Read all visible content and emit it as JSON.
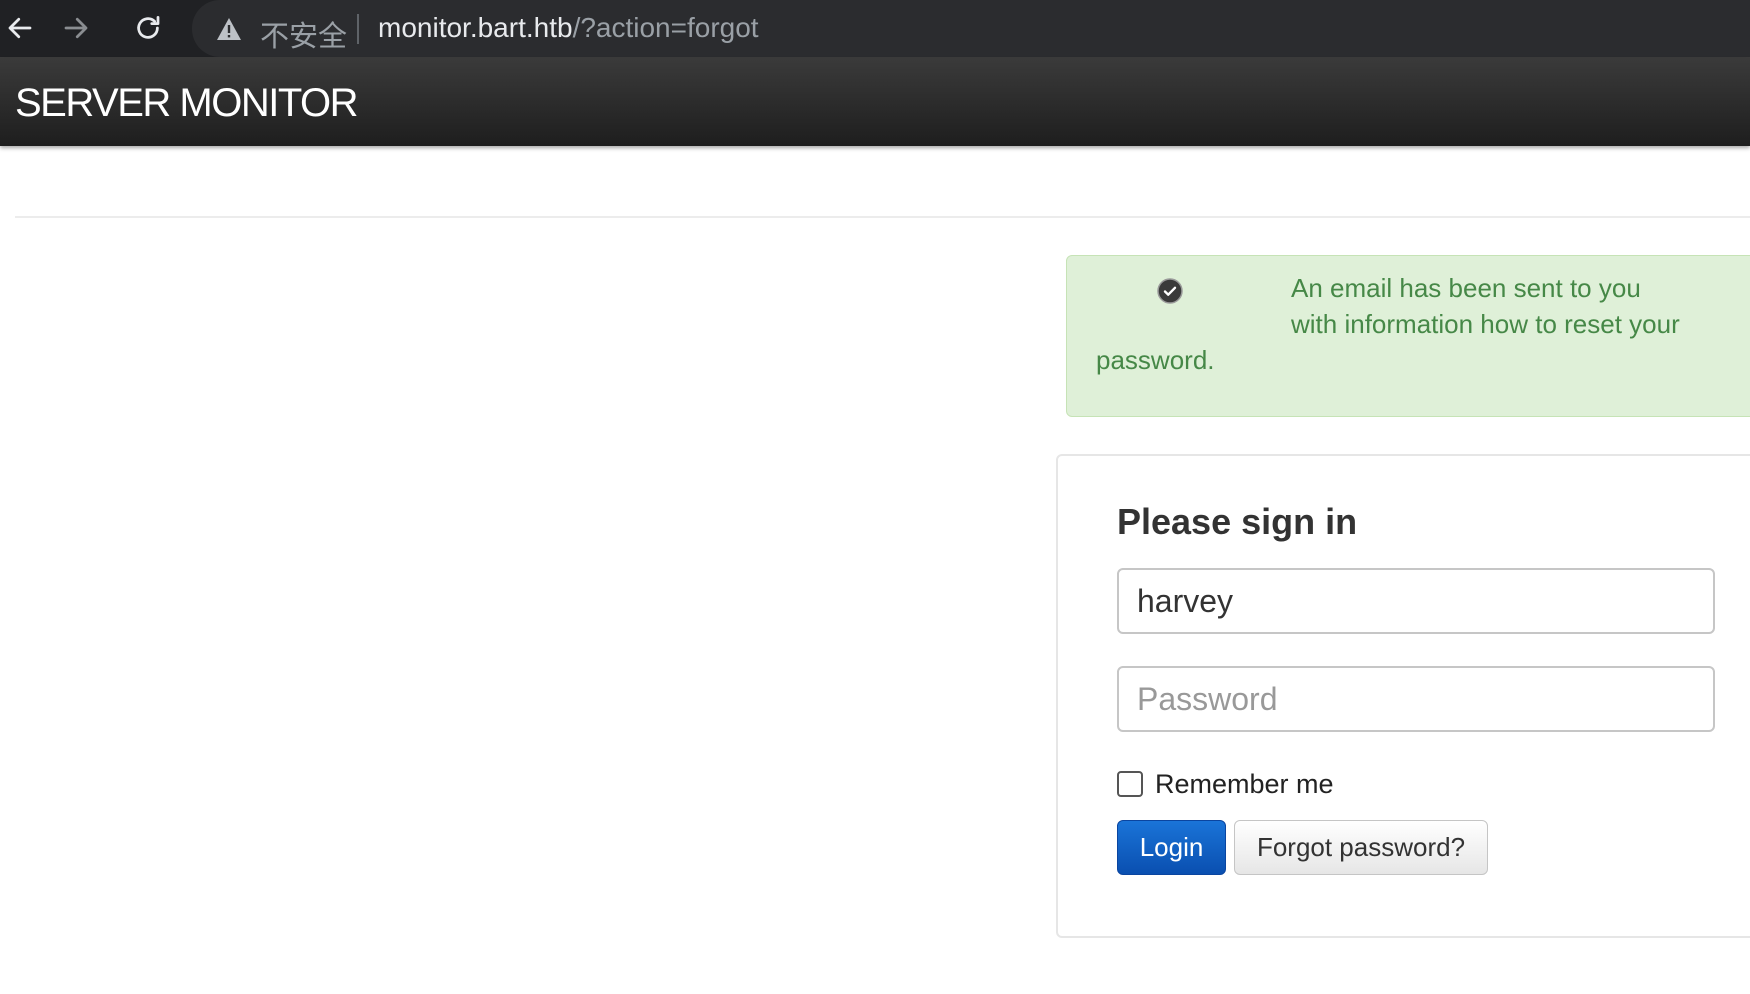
{
  "browser": {
    "not_secure_label": "不安全",
    "url_host": "monitor.bart.htb",
    "url_path": "/?action=forgot",
    "icons": [
      "back-arrow-icon",
      "forward-arrow-icon",
      "reload-icon",
      "warning-icon"
    ]
  },
  "navbar": {
    "brand": "SERVER MONITOR"
  },
  "alert": {
    "lines": [
      "An email has been sent to you",
      "with information how to reset your",
      "password."
    ],
    "icon": "check-circle-icon",
    "color": "#468847",
    "background": "#dff0d8"
  },
  "signin": {
    "title": "Please sign in",
    "username_value": "harvey",
    "password_placeholder": "Password",
    "remember_label": "Remember me",
    "remember_checked": false,
    "login_label": "Login",
    "forgot_label": "Forgot password?"
  },
  "colors": {
    "primary_button": "#0e5bc2",
    "navbar": "#222222"
  }
}
